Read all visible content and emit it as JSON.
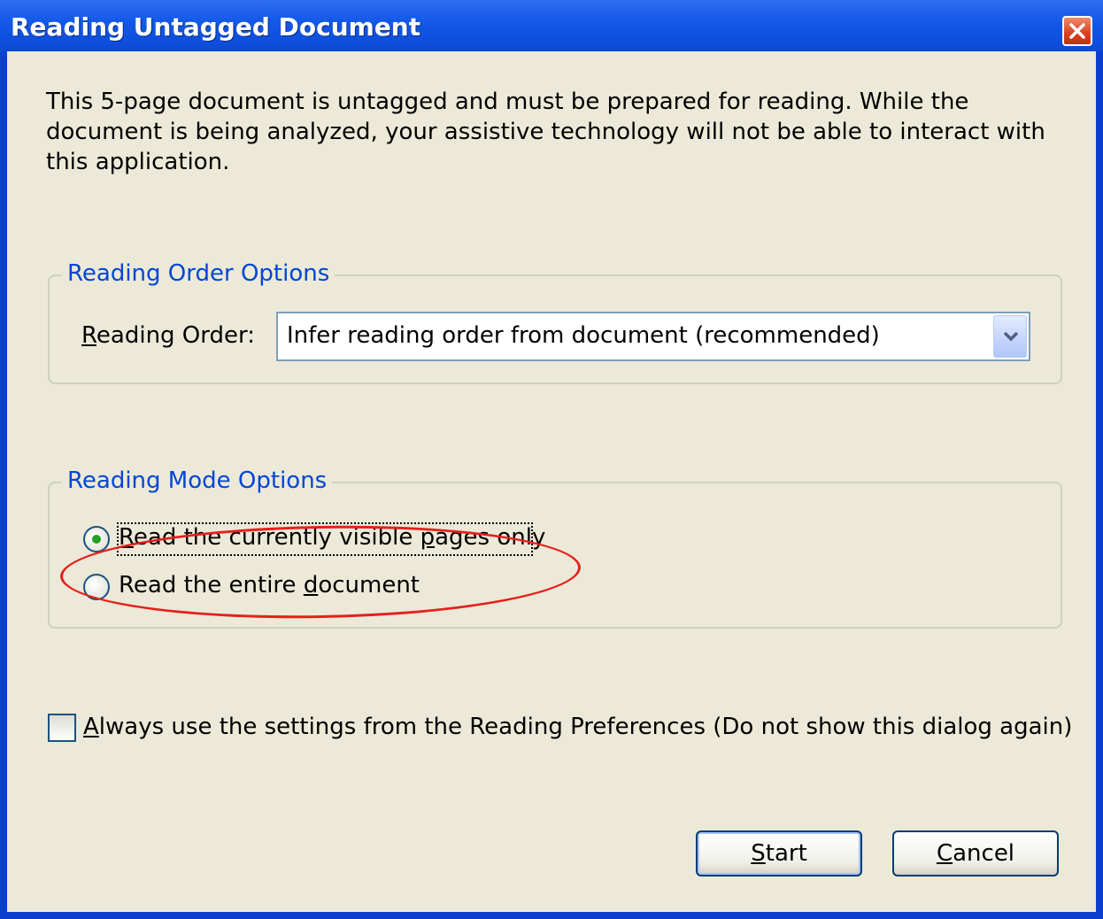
{
  "window": {
    "title": "Reading Untagged Document",
    "close_icon": "close-icon"
  },
  "message": "This 5-page document is untagged and must be prepared for reading. While the document is being analyzed, your assistive technology will not be able to interact with this application.",
  "reading_order_group": {
    "legend": "Reading Order Options",
    "label_accel": "R",
    "label_rest": "eading Order:",
    "combo_value": "Infer reading order from document (recommended)"
  },
  "reading_mode_group": {
    "legend": "Reading Mode Options",
    "option1_accel": "R",
    "option1_rest": "ead the currently visible ",
    "option1_accel2": "p",
    "option1_rest2": "ages only",
    "option2_pre": "Read the entire ",
    "option2_accel": "d",
    "option2_rest": "ocument",
    "selected": "option1"
  },
  "checkbox": {
    "accel": "A",
    "rest": "lways use the settings from the Reading Preferences (Do not show this dialog again)",
    "checked": false
  },
  "buttons": {
    "start_accel": "S",
    "start_rest": "tart",
    "cancel_accel": "C",
    "cancel_rest": "ancel"
  },
  "colors": {
    "titlebar": "#0b4ad6",
    "legend": "#0046d5",
    "highlight_ellipse": "#e5201b"
  }
}
